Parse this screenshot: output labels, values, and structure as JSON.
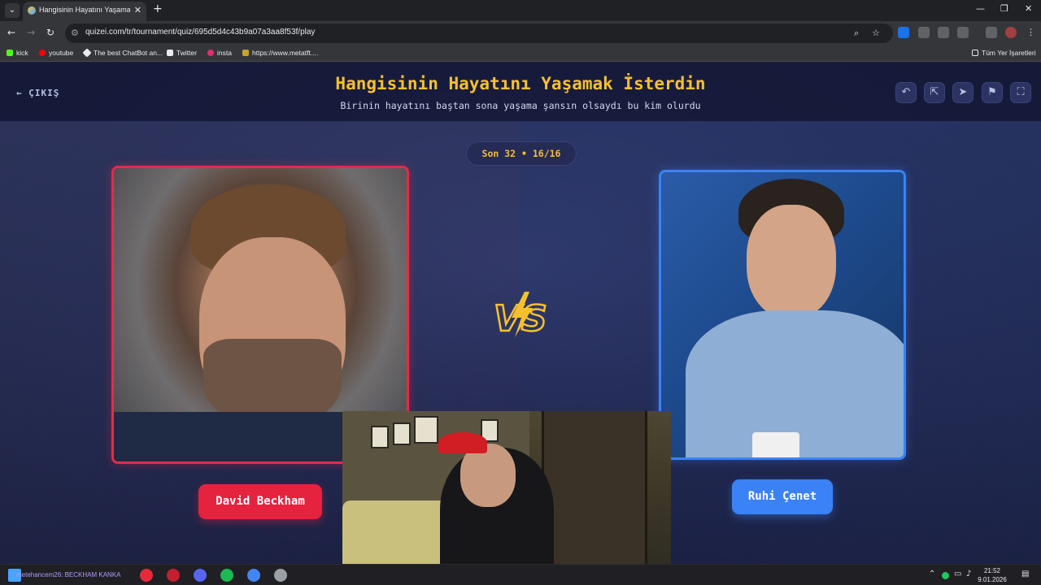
{
  "browser": {
    "tab_title": "Hangisinin Hayatını Yaşamak İs",
    "tab_close": "✕",
    "new_tab": "+",
    "url": "quizei.com/tr/tournament/quiz/695d5d4c43b9a07a3aa8f53f/play",
    "window_controls": {
      "minimize": "—",
      "maximize": "❐",
      "close": "✕"
    }
  },
  "bookmarks": [
    {
      "label": "kick",
      "color": "#53fc18"
    },
    {
      "label": "youtube",
      "color": "#ff0000"
    },
    {
      "label": "The best ChatBot an...",
      "color": "#e8eaed"
    },
    {
      "label": "Twitter",
      "color": "#e8eaed"
    },
    {
      "label": "insta",
      "color": "#e1306c"
    },
    {
      "label": "https://www.metatft....",
      "color": "#c9a227"
    }
  ],
  "bookmarks_all": "Tüm Yer İşaretleri",
  "header": {
    "back_label": "ÇIKIŞ",
    "title": "Hangisinin Hayatını Yaşamak İsterdin",
    "subtitle": "Birinin hayatını baştan sona yaşama şansın olsaydı bu kim olurdu"
  },
  "round": {
    "label": "Son 32 • 16/16"
  },
  "contestants": {
    "left": {
      "name": "David Beckham",
      "accent": "#e5233f"
    },
    "right": {
      "name": "Ruhi Çenet",
      "accent": "#3b82f6"
    }
  },
  "vs_label": "VS",
  "taskbar": {
    "overlay_text": "metehancem26: BECKHAM KANKA",
    "time": "21:52",
    "date": "9.01.2026"
  },
  "colors": {
    "title": "#f5c030",
    "page_bg": "#1c2146"
  }
}
